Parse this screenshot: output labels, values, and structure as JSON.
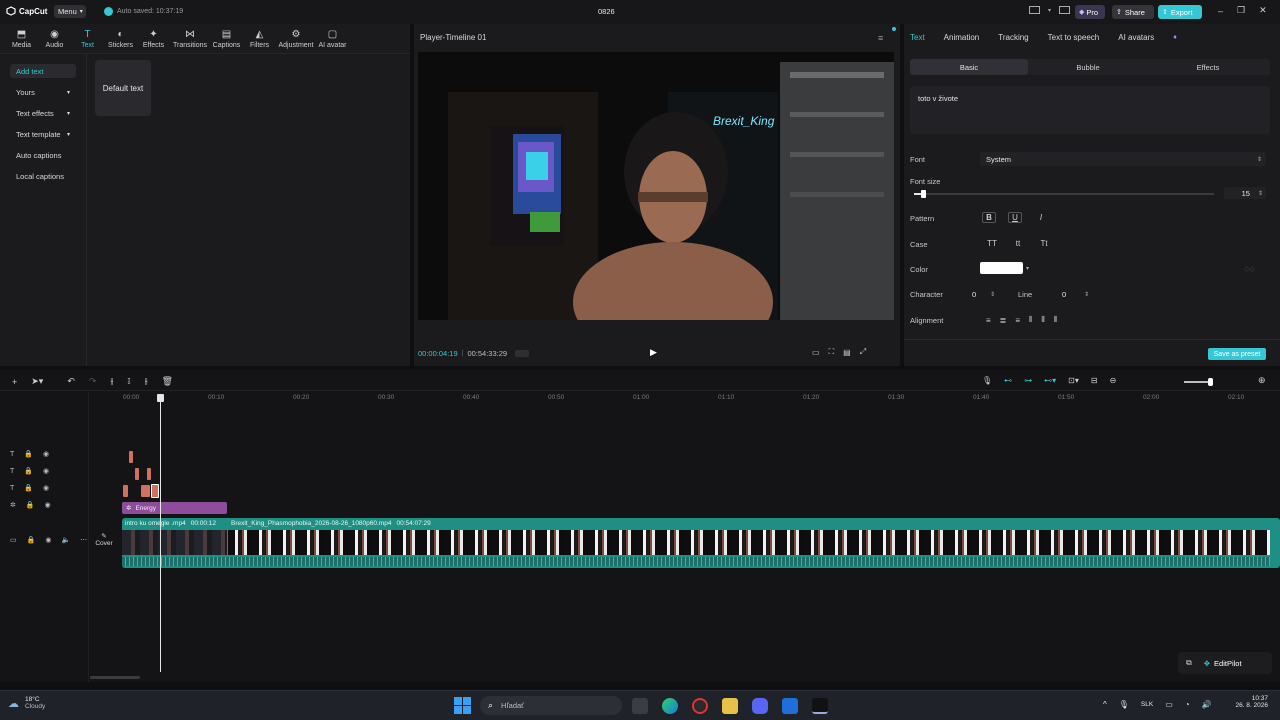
{
  "titlebar": {
    "app_name": "CapCut",
    "menu_label": "Menu",
    "autosave": "Auto saved: 10:37:19",
    "project_name": "0826",
    "pro_label": "Pro",
    "share_label": "Share",
    "export_label": "Export"
  },
  "toolbar": {
    "items": [
      {
        "label": "Media",
        "icon": "media-icon"
      },
      {
        "label": "Audio",
        "icon": "audio-icon"
      },
      {
        "label": "Text",
        "icon": "text-icon"
      },
      {
        "label": "Stickers",
        "icon": "stickers-icon"
      },
      {
        "label": "Effects",
        "icon": "effects-icon"
      },
      {
        "label": "Transitions",
        "icon": "transitions-icon"
      },
      {
        "label": "Captions",
        "icon": "captions-icon"
      },
      {
        "label": "Filters",
        "icon": "filters-icon"
      },
      {
        "label": "Adjustment",
        "icon": "adjustment-icon"
      },
      {
        "label": "AI avatar",
        "icon": "ai-avatar-icon"
      }
    ]
  },
  "leftpanel": {
    "items": [
      "Add text",
      "Yours",
      "Text effects",
      "Text template",
      "Auto captions",
      "Local captions"
    ],
    "default_text": "Default text"
  },
  "player": {
    "title": "Player-Timeline 01",
    "current_time": "00:00:04:19",
    "total_time": "00:54:33:29",
    "neon_text": "Brexit_King"
  },
  "rightpanel": {
    "tabs": [
      "Text",
      "Animation",
      "Tracking",
      "Text to speech",
      "AI avatars"
    ],
    "subtabs": [
      "Basic",
      "Bubble",
      "Effects"
    ],
    "text_value": "toto v živote",
    "font_label": "Font",
    "font_value": "System",
    "fontsize_label": "Font size",
    "fontsize_value": "15",
    "fontsize_fraction": 0.03,
    "pattern_label": "Pattern",
    "case_label": "Case",
    "case_options": [
      "TT",
      "tt",
      "Tt"
    ],
    "color_label": "Color",
    "color_value": "#ffffff",
    "character_label": "Character",
    "character_value": "0",
    "line_label": "Line",
    "line_value": "0",
    "alignment_label": "Alignment",
    "save_preset": "Save as preset"
  },
  "timeline": {
    "ruler": [
      "00:00",
      "00:10",
      "00:20",
      "00:30",
      "00:40",
      "00:50",
      "01:00",
      "01:10",
      "01:20",
      "01:30",
      "01:40",
      "01:50",
      "02:00",
      "02:10"
    ],
    "effect_clip": "Energy",
    "clip1_name": "intro ku omegle .mp4",
    "clip1_dur": "00:00:12",
    "clip2_name": "Brexit_King_Phasmophobia_2026-08-26_1080p60.mp4",
    "clip2_dur": "00:54:07:29",
    "cover_label": "Cover",
    "editpilot_label": "EditPilot"
  },
  "taskbar": {
    "weather_temp": "18°C",
    "weather_desc": "Cloudy",
    "search_placeholder": "Hľadať",
    "lang": "SLK",
    "time": "10:37",
    "date": "26. 8. 2026"
  },
  "colors": {
    "accent": "#36c7d4",
    "pro_badge": "#3a3550",
    "effect_clip": "#8e4d9b",
    "video_track": "#1f8f86"
  }
}
